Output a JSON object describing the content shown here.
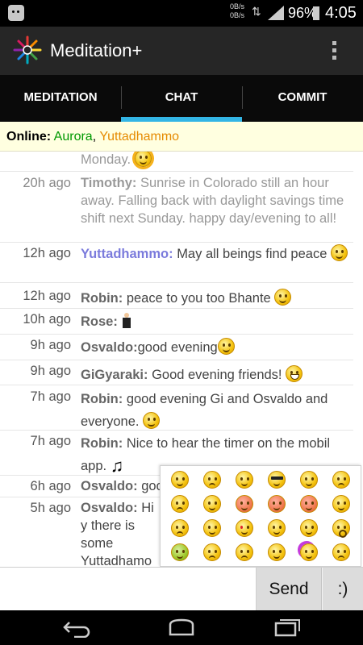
{
  "status_bar": {
    "net_up": "0B/s",
    "net_down": "0B/s",
    "battery": "96%",
    "time": "4:05"
  },
  "app": {
    "title": "Meditation+"
  },
  "tabs": [
    {
      "label": "MEDITATION",
      "active": false
    },
    {
      "label": "CHAT",
      "active": true
    },
    {
      "label": "COMMIT",
      "active": false
    }
  ],
  "online": {
    "label": "Online:",
    "users": [
      "Aurora",
      "Yuttadhammo"
    ],
    "separator": ", "
  },
  "messages": [
    {
      "time": "",
      "name": "",
      "text": "Monday.",
      "emoji": "sun"
    },
    {
      "time": "20h ago",
      "name": "Timothy:",
      "text": "Sunrise in Colorado still an hour away. Falling back with daylight savings time shift next Sunday. happy day/evening to all!"
    },
    {
      "time": "12h ago",
      "name": "Yuttadhammo:",
      "text": "May all beings find peace",
      "emoji": "smile"
    },
    {
      "time": "12h ago",
      "name": "Robin:",
      "text": "peace to you too Bhante",
      "emoji": "smile"
    },
    {
      "time": "10h ago",
      "name": "Rose:",
      "text": "",
      "emoji": "person"
    },
    {
      "time": "9h ago",
      "name": "Osvaldo:",
      "text": "good evening",
      "emoji": "smile"
    },
    {
      "time": "9h ago",
      "name": "GiGyaraki:",
      "text": "Good evening friends!",
      "emoji": "grin"
    },
    {
      "time": "7h ago",
      "name": "Robin:",
      "text": "good evening Gi and Osvaldo and everyone.",
      "emoji": "wave"
    },
    {
      "time": "7h ago",
      "name": "Robin:",
      "text": "Nice to hear the timer on the mobil app.",
      "emoji": "note"
    },
    {
      "time": "6h ago",
      "name": "Osvaldo:",
      "text": "goo"
    },
    {
      "time": "5h ago",
      "name": "Osvaldo:",
      "text": "Hi y there is some Yuttadhamo daily meal? t"
    }
  ],
  "emoji_picker": [
    "smile",
    "sad",
    "grin",
    "cool",
    "wink",
    "cry",
    "worried",
    "neutral",
    "kiss",
    "tongue",
    "angry",
    "confused",
    "sleepy",
    "relieved",
    "love",
    "laugh",
    "blush",
    "shock",
    "sick",
    "annoyed",
    "frown",
    "think",
    "party",
    "blank"
  ],
  "input": {
    "placeholder": "",
    "value": "",
    "send_label": "Send",
    "emoji_label": ":)"
  }
}
